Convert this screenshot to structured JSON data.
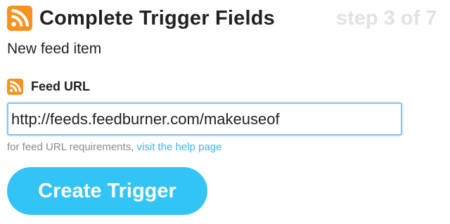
{
  "header": {
    "icon": "rss-icon",
    "icon_color": "#f7921e",
    "title": "Complete Trigger Fields",
    "step": "step 3 of 7"
  },
  "trigger": {
    "subtitle": "New feed item"
  },
  "field": {
    "icon": "rss-icon",
    "label": "Feed URL",
    "value": "http://feeds.feedburner.com/makeuseof"
  },
  "help": {
    "text": "for feed URL requirements,",
    "link_label": "visit the help page",
    "link_color": "#3fb7e4"
  },
  "button": {
    "label": "Create Trigger",
    "color": "#33c4f6"
  }
}
